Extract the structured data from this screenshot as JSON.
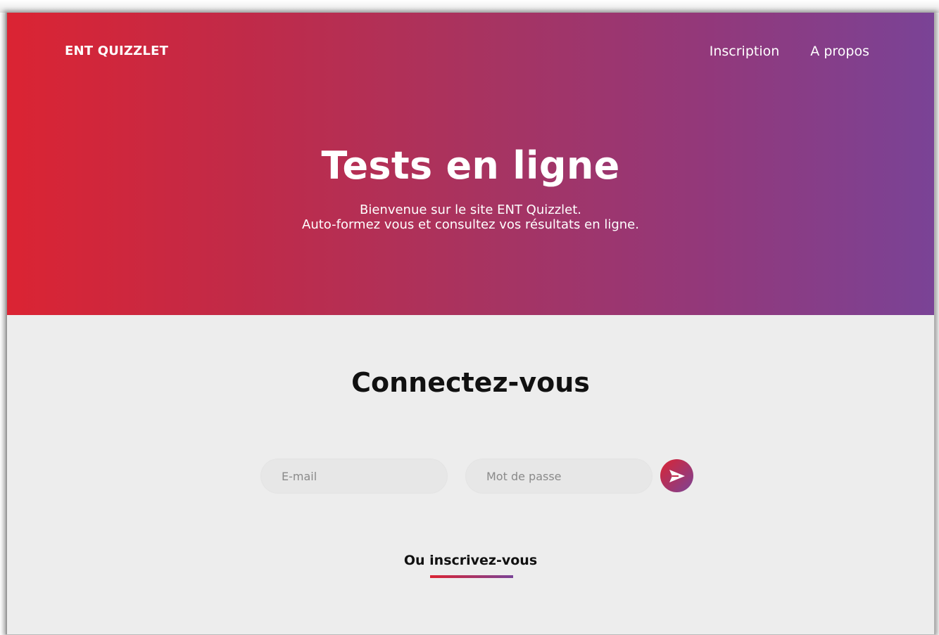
{
  "header": {
    "brand": "ENT QUIZZLET",
    "nav": [
      {
        "label": "Inscription"
      },
      {
        "label": "A propos"
      }
    ]
  },
  "hero": {
    "title": "Tests en ligne",
    "subtitle_line1": "Bienvenue sur le site ENT Quizzlet.",
    "subtitle_line2": "Auto-formez vous et consultez vos résultats en ligne."
  },
  "login": {
    "title": "Connectez-vous",
    "email_placeholder": "E-mail",
    "password_placeholder": "Mot de passe",
    "submit_icon": "send-icon",
    "signup_label": "Ou inscrivez-vous"
  },
  "colors": {
    "gradient_start": "#db2433",
    "gradient_end": "#7a4396",
    "background": "#ededed"
  }
}
